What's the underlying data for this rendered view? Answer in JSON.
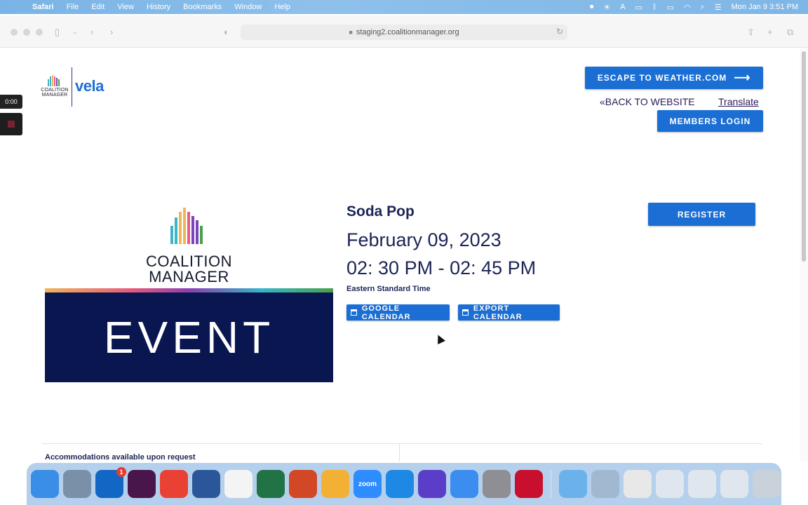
{
  "menubar": {
    "app": "Safari",
    "items": [
      "File",
      "Edit",
      "View",
      "History",
      "Bookmarks",
      "Window",
      "Help"
    ],
    "clock": "Mon Jan 9  3:51 PM"
  },
  "browser": {
    "url": "staging2.coalitionmanager.org"
  },
  "site": {
    "logo_cm_text": "COALITION\nMANAGER",
    "logo_vela_text": "vela",
    "escape_label": "ESCAPE TO WEATHER.COM",
    "back_label": "«BACK TO WEBSITE",
    "translate_label": "Translate",
    "members_label": "MEMBERS LOGIN"
  },
  "recorder": {
    "time": "0:00"
  },
  "event": {
    "image_brand": "COALITION\nMANAGER",
    "image_banner": "EVENT",
    "title": "Soda Pop",
    "date": "February 09, 2023",
    "time": "02: 30 PM - 02: 45 PM",
    "timezone": "Eastern Standard Time",
    "google_calendar_label": "GOOGLE CALENDAR",
    "export_calendar_label": "EXPORT CALENDAR",
    "register_label": "REGISTER",
    "accommodations": "Accommodations available upon request"
  },
  "colors": {
    "primary_button": "#1b6ed3",
    "navy_text": "#1b2556",
    "event_panel": "#0a1650"
  },
  "dock": {
    "apps": [
      {
        "name": "Finder",
        "icon": "finder-icon",
        "color": "#3a8ee6"
      },
      {
        "name": "Launchpad",
        "icon": "launchpad-icon",
        "color": "#7a8fa8"
      },
      {
        "name": "Outlook",
        "icon": "outlook-icon",
        "color": "#1267c4",
        "badge": "1"
      },
      {
        "name": "Slack",
        "icon": "slack-icon",
        "color": "#4a154b"
      },
      {
        "name": "Chrome",
        "icon": "chrome-icon",
        "color": "#e94235"
      },
      {
        "name": "Word",
        "icon": "word-icon",
        "color": "#2b579a"
      },
      {
        "name": "Reminders",
        "icon": "reminders-icon",
        "color": "#f4f4f4"
      },
      {
        "name": "Excel",
        "icon": "excel-icon",
        "color": "#217346"
      },
      {
        "name": "PowerPoint",
        "icon": "powerpoint-icon",
        "color": "#d24726"
      },
      {
        "name": "Photos",
        "icon": "photos-icon",
        "color": "#f2b134"
      },
      {
        "name": "Zoom",
        "icon": "zoom-icon",
        "color": "#2d8cff"
      },
      {
        "name": "Safari",
        "icon": "safari-icon",
        "color": "#1d89e4"
      },
      {
        "name": "Perplexity",
        "icon": "sparkle-icon",
        "color": "#5a3ec8"
      },
      {
        "name": "Mail",
        "icon": "mail-icon",
        "color": "#3b8ef0"
      },
      {
        "name": "System Preferences",
        "icon": "gear-icon",
        "color": "#8e8e93"
      },
      {
        "name": "Acrobat",
        "icon": "acrobat-icon",
        "color": "#c8102e"
      },
      {
        "name": "Folder",
        "icon": "folder-icon",
        "color": "#6cb2ea"
      },
      {
        "name": "Help",
        "icon": "question-icon",
        "color": "#a0b8d0"
      },
      {
        "name": "Document",
        "icon": "document-icon",
        "color": "#e8e8e8"
      },
      {
        "name": "Screenshot 1",
        "icon": "screenshot-icon",
        "color": "#dfe6ee"
      },
      {
        "name": "Screenshot 2",
        "icon": "screenshot-icon",
        "color": "#dfe6ee"
      },
      {
        "name": "Screenshot 3",
        "icon": "screenshot-icon",
        "color": "#dfe6ee"
      },
      {
        "name": "Trash",
        "icon": "trash-icon",
        "color": "#c9d1da"
      }
    ],
    "zoom_label": "zoom"
  }
}
